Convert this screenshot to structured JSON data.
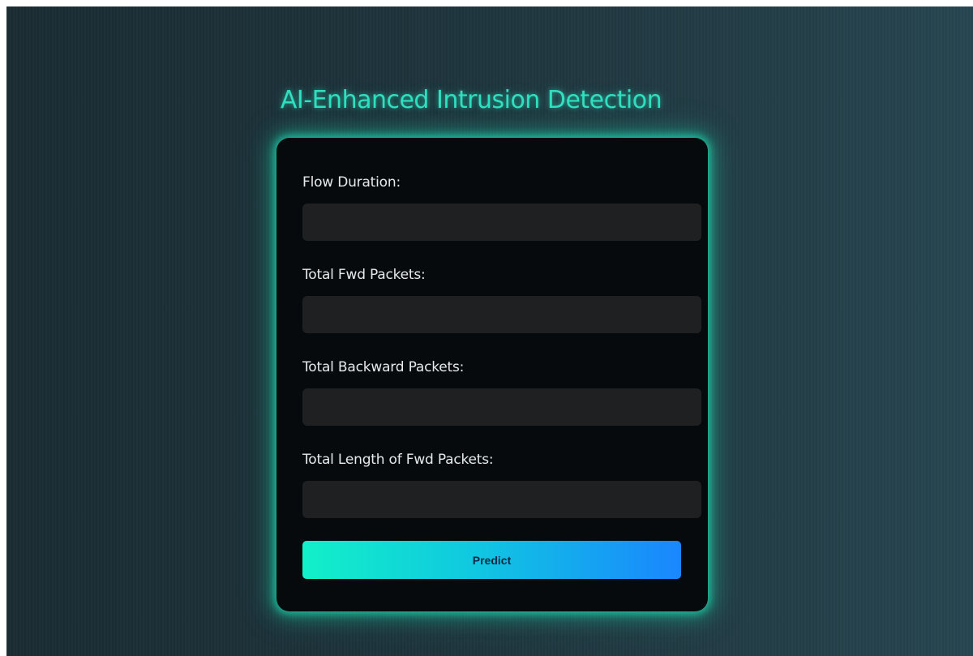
{
  "header": {
    "title": "AI-Enhanced Intrusion Detection"
  },
  "form": {
    "fields": [
      {
        "label": "Flow Duration:",
        "value": ""
      },
      {
        "label": "Total Fwd Packets:",
        "value": ""
      },
      {
        "label": "Total Backward Packets:",
        "value": ""
      },
      {
        "label": "Total Length of Fwd Packets:",
        "value": ""
      }
    ],
    "submit_label": "Predict"
  },
  "colors": {
    "accent": "#2fe0c0",
    "card_background": "#070a0c",
    "input_background": "#1f2021",
    "button_gradient_start": "#12f0c8",
    "button_gradient_end": "#1a86ff"
  }
}
